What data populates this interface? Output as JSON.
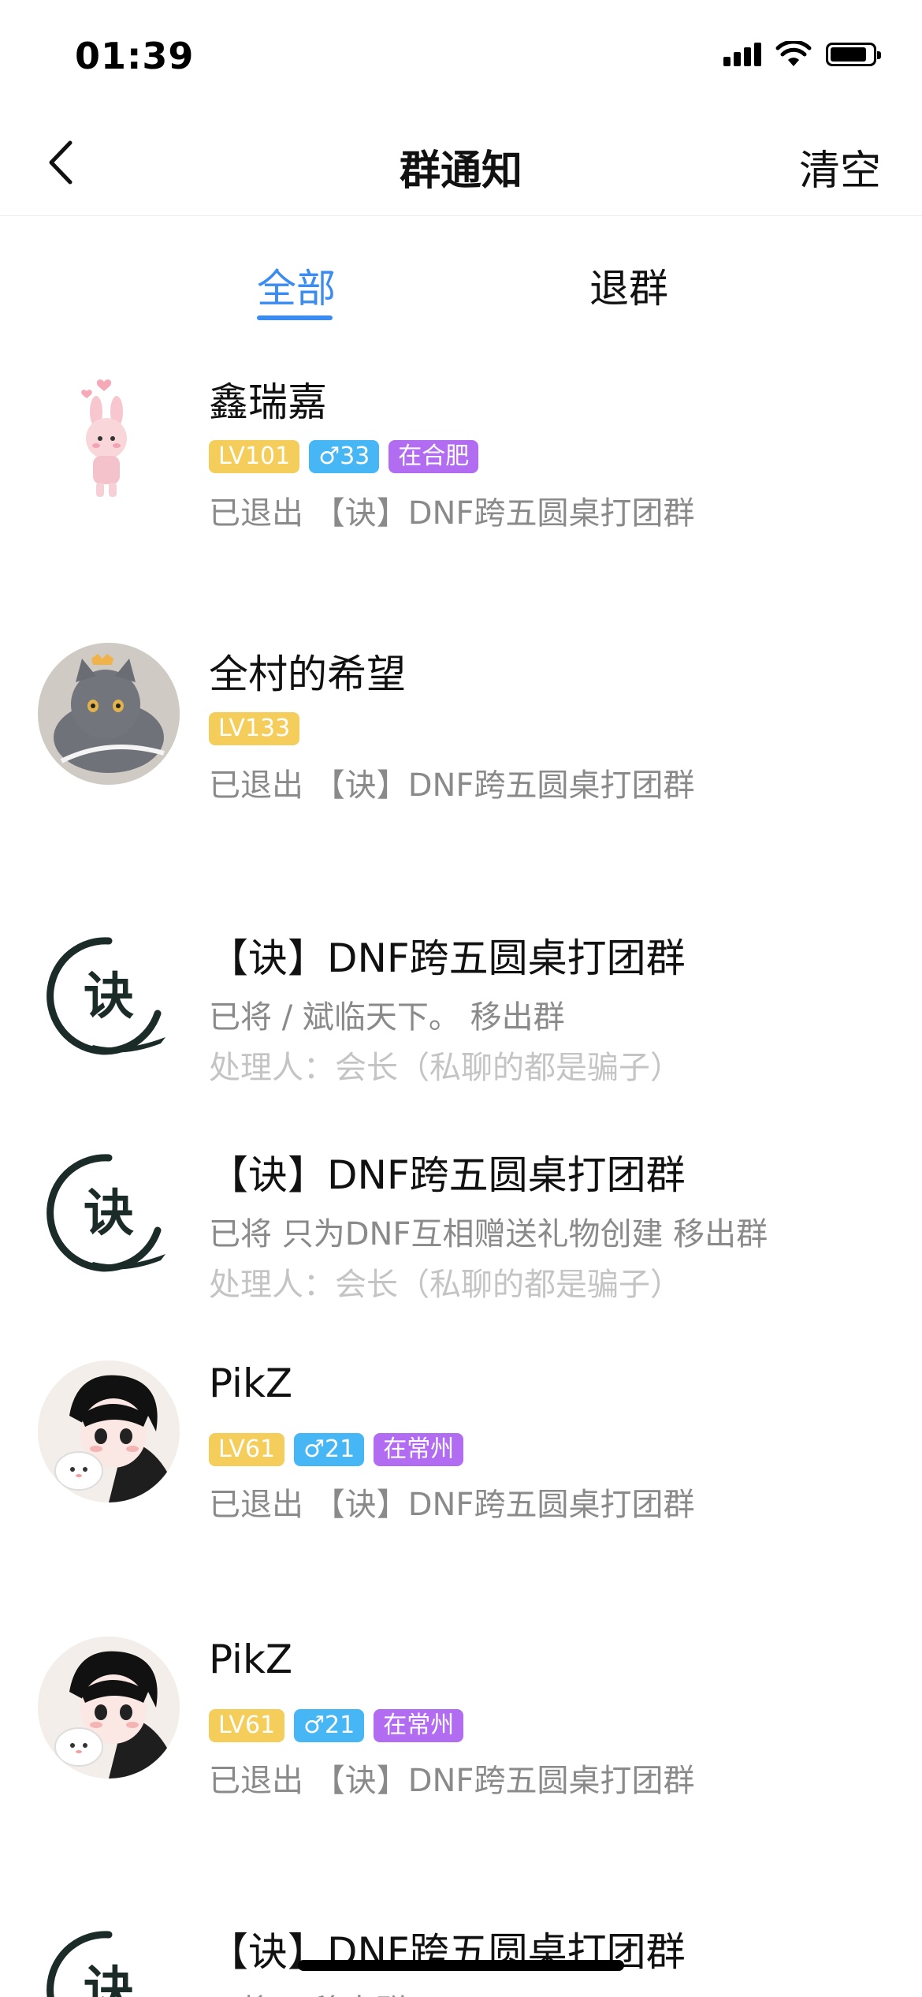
{
  "status_bar": {
    "time": "01:39"
  },
  "nav": {
    "title": "群通知",
    "clear_label": "清空"
  },
  "tabs": [
    {
      "label": "全部",
      "active": true
    },
    {
      "label": "退群",
      "active": false
    }
  ],
  "items": [
    {
      "kind": "user_exit",
      "avatar": "cartoon-rabbit-avatar",
      "name": "鑫瑞嘉",
      "tags": {
        "level": "LV101",
        "gender": "♂33",
        "city": "在合肥"
      },
      "desc": "已退出 【诀】DNF跨五圆桌打团群"
    },
    {
      "kind": "user_exit",
      "avatar": "cat-photo-avatar",
      "name": "全村的希望",
      "tags": {
        "level": "LV133"
      },
      "desc": "已退出 【诀】DNF跨五圆桌打团群"
    },
    {
      "kind": "group_remove",
      "avatar": "group-jue-logo",
      "name": "【诀】DNF跨五圆桌打团群",
      "desc": "已将 / 斌临天下。 移出群",
      "handler": "处理人：会长（私聊的都是骗子）"
    },
    {
      "kind": "group_remove",
      "avatar": "group-jue-logo",
      "name": "【诀】DNF跨五圆桌打团群",
      "desc": "已将 只为DNF互相赠送礼物创建 移出群",
      "handler": "处理人：会长（私聊的都是骗子）"
    },
    {
      "kind": "user_exit",
      "avatar": "anime-boy-avatar",
      "name": "PikZ",
      "tags": {
        "level": "LV61",
        "gender": "♂21",
        "city": "在常州"
      },
      "desc": "已退出 【诀】DNF跨五圆桌打团群"
    },
    {
      "kind": "user_exit",
      "avatar": "anime-boy-avatar",
      "name": "PikZ",
      "tags": {
        "level": "LV61",
        "gender": "♂21",
        "city": "在常州"
      },
      "desc": "已退出 【诀】DNF跨五圆桌打团群"
    },
    {
      "kind": "group_remove",
      "avatar": "group-jue-logo",
      "name": "【诀】DNF跨五圆桌打团群",
      "desc": "已将 ·· 移出群"
    }
  ]
}
